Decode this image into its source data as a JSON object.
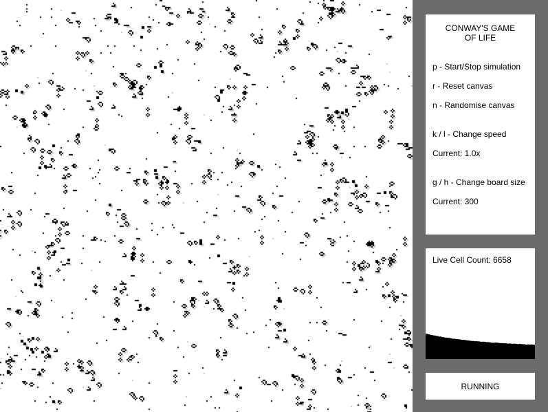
{
  "game": {
    "title_line1": "CONWAY'S GAME",
    "title_line2": "OF LIFE",
    "colors": {
      "background": "#6b6b6b",
      "panel": "#ffffff",
      "cell_alive": "#000000",
      "cell_fading": "#c8c8c8",
      "board": "#ffffff"
    }
  },
  "controls": {
    "start_stop": "p - Start/Stop simulation",
    "reset": "r - Reset canvas",
    "randomise": "n - Randomise canvas",
    "speed_keys": "k / l - Change speed",
    "speed_current": "Current: 1.0x",
    "size_keys": "g / h - Change board size",
    "size_current": "Current: 300"
  },
  "stats": {
    "count_label": "Live Cell Count: 6658",
    "live_cell_count": 6658,
    "history_fraction_start": 0.23,
    "history_fraction_end": 0.13
  },
  "status": {
    "text": "RUNNING"
  }
}
